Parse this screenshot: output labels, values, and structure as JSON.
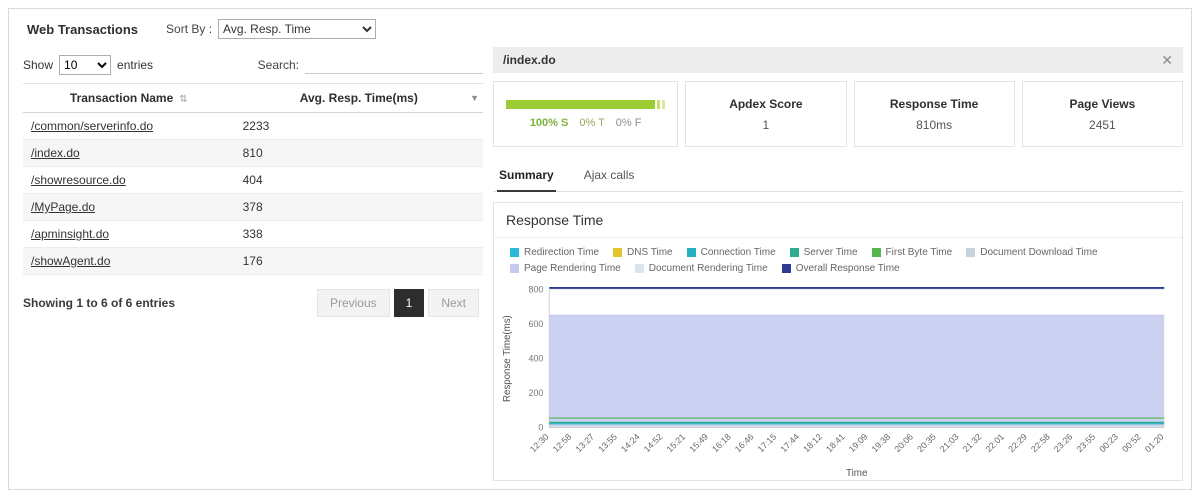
{
  "header": {
    "title": "Web Transactions",
    "sort_by_label": "Sort By :",
    "sort_by_value": "Avg. Resp. Time"
  },
  "left_panel": {
    "show_label": "Show",
    "show_value": "10",
    "entries_label": "entries",
    "search_label": "Search:",
    "search_value": "",
    "table": {
      "col_name": "Transaction Name",
      "col_value": "Avg. Resp. Time(ms)",
      "sort_icon": "⇅",
      "filter_icon": "▼",
      "rows": [
        {
          "name": "/common/serverinfo.do",
          "value": "2233"
        },
        {
          "name": "/index.do",
          "value": "810"
        },
        {
          "name": "/showresource.do",
          "value": "404"
        },
        {
          "name": "/MyPage.do",
          "value": "378"
        },
        {
          "name": "/apminsight.do",
          "value": "338"
        },
        {
          "name": "/showAgent.do",
          "value": "176"
        }
      ]
    },
    "footer": {
      "info": "Showing 1 to 6 of 6 entries",
      "previous": "Previous",
      "page": "1",
      "next": "Next"
    }
  },
  "detail_panel": {
    "title": "/index.do",
    "close_label": "✕",
    "apdex_card": {
      "satisfied": "100% S",
      "tolerating": "0% T",
      "frustrated": "0% F",
      "bar_color": "#9bcc33",
      "bar_color_t": "#c6df6d",
      "bar_color_f": "#dcebA0"
    },
    "cards": [
      {
        "title": "Apdex Score",
        "value": "1"
      },
      {
        "title": "Response Time",
        "value": "810ms"
      },
      {
        "title": "Page Views",
        "value": "2451"
      }
    ],
    "tabs": [
      {
        "label": "Summary",
        "active": true
      },
      {
        "label": "Ajax calls",
        "active": false
      }
    ]
  },
  "chart_data": {
    "type": "area",
    "title": "Response Time",
    "xlabel": "Time",
    "ylabel": "Response Time(ms)",
    "ylim": [
      0,
      800
    ],
    "yticks": [
      0,
      200,
      400,
      600,
      800
    ],
    "grid": true,
    "legend_position": "top",
    "categories": [
      "12:30",
      "12:58",
      "13:27",
      "13:55",
      "14:24",
      "14:52",
      "15:21",
      "15:49",
      "16:18",
      "16:46",
      "17:15",
      "17:44",
      "18:12",
      "18:41",
      "19:09",
      "19:38",
      "20:06",
      "20:35",
      "21:03",
      "21:32",
      "22:01",
      "22:29",
      "22:58",
      "23:26",
      "23:55",
      "00:23",
      "00:52",
      "01:20"
    ],
    "note": "All series are flat (constant value) across the full time range",
    "series": [
      {
        "name": "Redirection Time",
        "color": "#2fb8d8",
        "style": "line",
        "constant_value": 4
      },
      {
        "name": "DNS Time",
        "color": "#e3c62e",
        "style": "line",
        "constant_value": 4
      },
      {
        "name": "Connection Time",
        "color": "#23b0c1",
        "style": "line",
        "constant_value": 22
      },
      {
        "name": "Server Time",
        "color": "#2fae8f",
        "style": "line",
        "constant_value": 30
      },
      {
        "name": "First Byte Time",
        "color": "#57b54e",
        "style": "line",
        "constant_value": 55
      },
      {
        "name": "Document Download Time",
        "color": "#c7d3da",
        "style": "line",
        "constant_value": 4
      },
      {
        "name": "Page Rendering Time",
        "color": "#c4c9ee",
        "style": "area",
        "constant_value": 650
      },
      {
        "name": "Document Rendering Time",
        "color": "#dde4ea",
        "style": "line",
        "constant_value": 4
      },
      {
        "name": "Overall Response Time",
        "color": "#2b3a93",
        "style": "line",
        "constant_value": 810
      }
    ]
  }
}
